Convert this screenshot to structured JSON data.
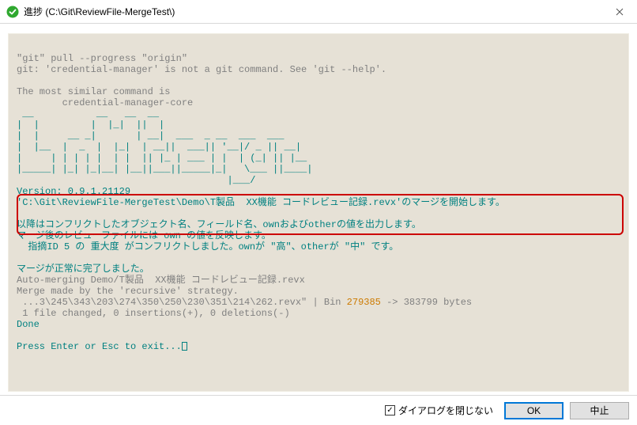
{
  "window": {
    "title": "進捗 (C:\\Git\\ReviewFile-MergeTest\\)",
    "close_tooltip": "閉じる"
  },
  "console": {
    "line01": "\"git\" pull --progress \"origin\"",
    "line02": "git: 'credential-manager' is not a git command. See 'git --help'.",
    "line03": "",
    "line04": "The most similar command is",
    "line05": "        credential-manager-core",
    "ascii01": " __           __   __  __",
    "ascii02": "|  |         |  |_|  ||  |",
    "ascii03": "|  |     __ _|       | __|  ___  _ __  ___  ___",
    "ascii04": "|  |__  |  _  |  |_|  | __||  ___|| '__|/ _ || __|",
    "ascii05": "|     | | | | |  | |  || |_ | ___ | |  | (_| || |__",
    "ascii06": "|_____| |_| |_|__| |__||___||_____|_|   \\___ ||____|",
    "ascii07": "                                     |___/",
    "line_version": "Version: 0.9.1.21129",
    "line_start": "'C:\\Git\\ReviewFile-MergeTest\\Demo\\T製品  XX機能 コードレビュー記録.revx'のマージを開始します。",
    "conflict1": "以降はコンフリクトしたオブジェクト名、フィールド名、ownおよびotherの値を出力します。",
    "conflict2": "マージ後のレビューファイルには own の値を反映します。",
    "conflict3": "  指摘ID 5 の 重大度 がコンフリクトしました。ownが \"高\"、otherが \"中\" です。",
    "line_done1": "マージが正常に完了しました。",
    "line_done2": "Auto-merging Demo/T製品  XX機能 コードレビュー記録.revx",
    "line_done3": "Merge made by the 'recursive' strategy.",
    "bin_pre": " ...3\\245\\343\\203\\274\\350\\250\\230\\351\\214\\262.revx\" | Bin ",
    "bin_old": "279385",
    "bin_post": " -> 383799 bytes",
    "line_changed": " 1 file changed, 0 insertions(+), 0 deletions(-)",
    "line_done": "Done",
    "line_prompt": "Press Enter or Esc to exit..."
  },
  "footer": {
    "keep_open_label": "ダイアログを閉じない",
    "keep_open_checked": true,
    "ok_label": "OK",
    "cancel_label": "中止"
  },
  "icons": {
    "app_icon": "check-circle-icon",
    "close": "close-icon",
    "checkmark": "✓"
  }
}
